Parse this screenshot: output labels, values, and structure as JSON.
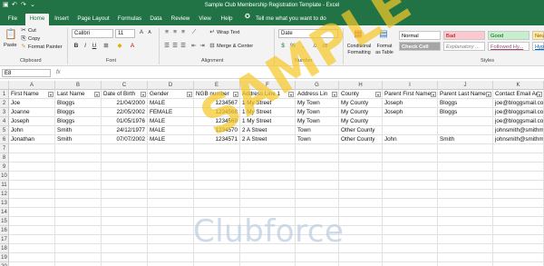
{
  "window": {
    "title": "Sample Club Membership Registration Template  -  Excel"
  },
  "tabs": [
    "File",
    "Home",
    "Insert",
    "Page Layout",
    "Formulas",
    "Data",
    "Review",
    "View",
    "Help"
  ],
  "tell_me": "Tell me what you want to do",
  "ribbon": {
    "clipboard": {
      "paste": "Paste",
      "cut": "Cut",
      "copy": "Copy",
      "format_painter": "Format Painter",
      "label": "Clipboard"
    },
    "font": {
      "family": "Calibri",
      "size": "11",
      "label": "Font"
    },
    "alignment": {
      "wrap_text": "Wrap Text",
      "merge_center": "Merge & Center",
      "label": "Alignment"
    },
    "number": {
      "format": "Date",
      "label": "Number"
    },
    "styles": {
      "conditional_formatting": "Conditional Formatting",
      "format_as_table": "Format as Table",
      "cells": [
        {
          "label": "Normal",
          "bg": "#ffffff",
          "fg": "#000000"
        },
        {
          "label": "Bad",
          "bg": "#ffc7ce",
          "fg": "#9c0006"
        },
        {
          "label": "Good",
          "bg": "#c6efce",
          "fg": "#006100"
        },
        {
          "label": "Neutral",
          "bg": "#ffeb9c",
          "fg": "#9c5700"
        },
        {
          "label": "Check Cell",
          "bg": "#a5a5a5",
          "fg": "#ffffff"
        },
        {
          "label": "Explanatory ...",
          "bg": "#ffffff",
          "fg": "#7f7f7f"
        },
        {
          "label": "Followed Hy...",
          "bg": "#ffffff",
          "fg": "#954f72"
        },
        {
          "label": "Hyperlink",
          "bg": "#ffffff",
          "fg": "#0563c1"
        }
      ],
      "label": "Styles"
    }
  },
  "formula_bar": {
    "name_box": "E8",
    "fx": "fx"
  },
  "columns": [
    "A",
    "B",
    "C",
    "D",
    "E",
    "F",
    "G",
    "H",
    "I",
    "J",
    "K"
  ],
  "rows": [
    "1",
    "2",
    "3",
    "4",
    "5",
    "6",
    "7",
    "8",
    "9",
    "10",
    "11",
    "12",
    "13",
    "14",
    "15",
    "16",
    "17",
    "18",
    "19",
    "20"
  ],
  "sheet": {
    "header": [
      "First Name",
      "Last Name",
      "Date of Birth",
      "Gender",
      "NGB number",
      "Address Line 1",
      "Address Lin",
      "County",
      "Parent First Name",
      "Parent Last Name",
      "Contact Email Ad"
    ],
    "data": [
      [
        "Joe",
        "Bloggs",
        "21/04/2000",
        "MALE",
        "1234567",
        "1 My Street",
        "My Town",
        "My County",
        "Joseph",
        "Bloggs",
        "joe@bloggsmail.co"
      ],
      [
        "Joanne",
        "Bloggs",
        "22/05/2002",
        "FEMALE",
        "1234568",
        "1 My Street",
        "My Town",
        "My County",
        "Joseph",
        "Bloggs",
        "joe@bloggsmail.co"
      ],
      [
        "Joseph",
        "Bloggs",
        "01/05/1976",
        "MALE",
        "1234569",
        "1 My Street",
        "My Town",
        "My County",
        "",
        "",
        "joe@bloggsmail.co"
      ],
      [
        "John",
        "Smith",
        "24/12/1977",
        "MALE",
        "1234570",
        "2 A Street",
        "Town",
        "Other County",
        "",
        "",
        "johnsmith@smithm"
      ],
      [
        "Jonathan",
        "Smith",
        "07/07/2002",
        "MALE",
        "1234571",
        "2 A Street",
        "Town",
        "Other County",
        "John",
        "Smith",
        "johnsmith@smithm"
      ]
    ]
  },
  "watermark": "SAMPLE",
  "logo": "Clubforce",
  "colors": {
    "excel_green": "#217346",
    "watermark": "#f5c828"
  }
}
